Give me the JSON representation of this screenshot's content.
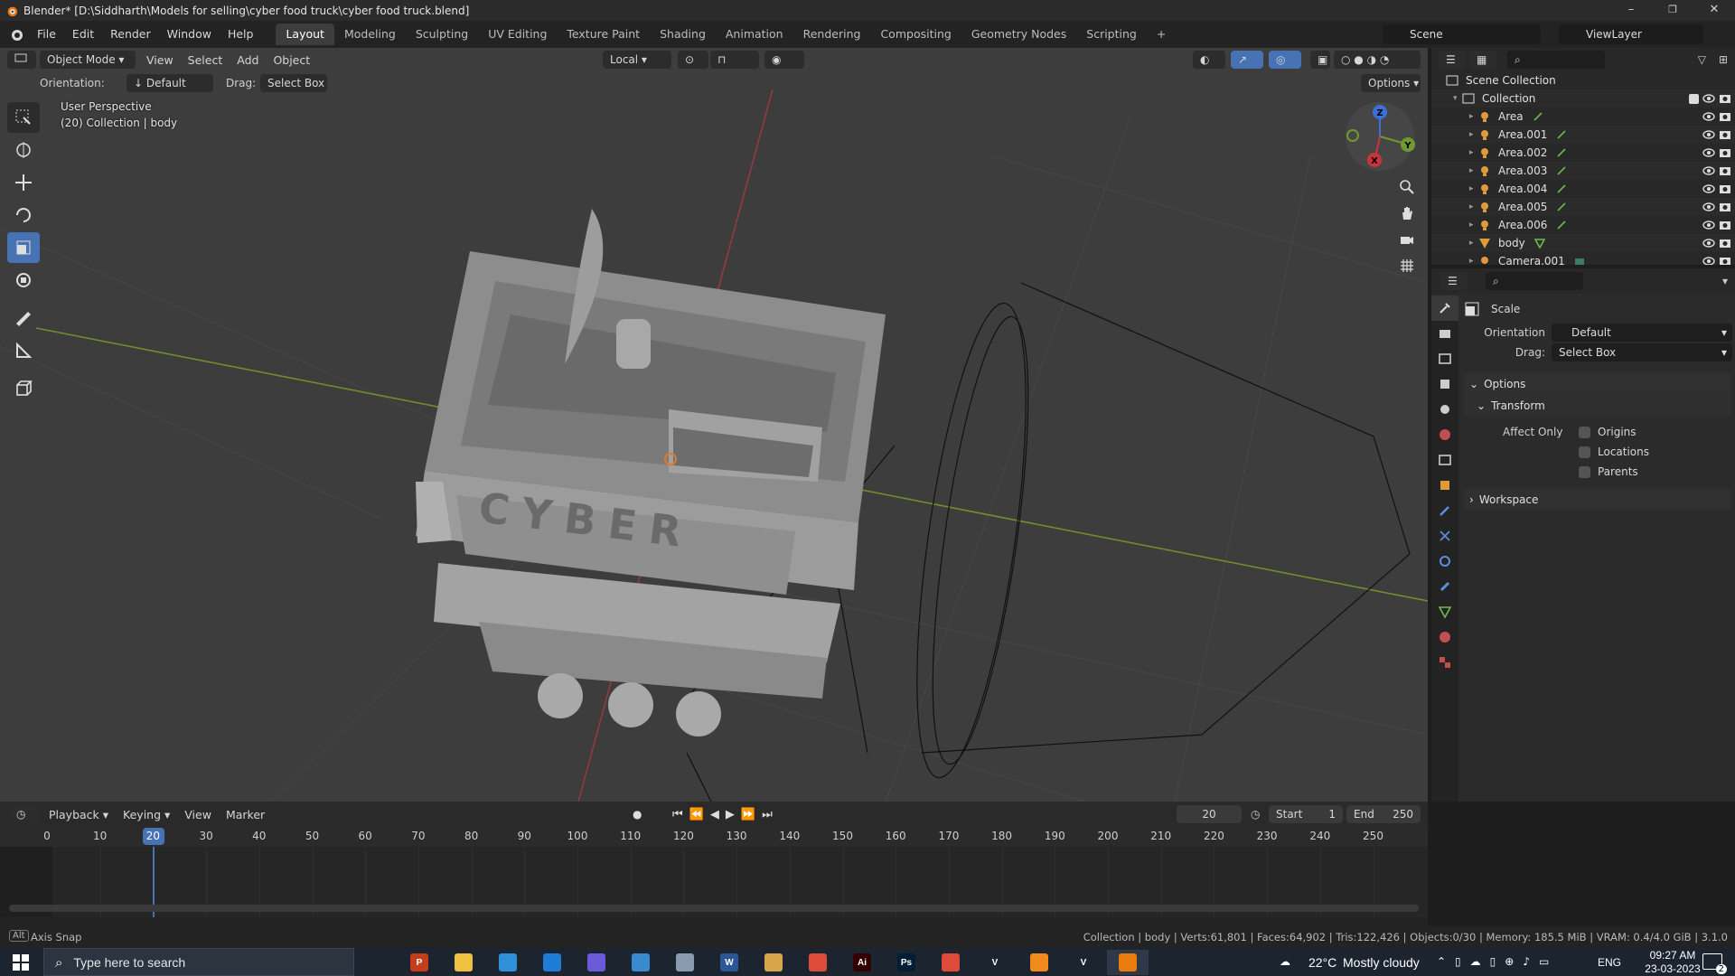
{
  "window": {
    "title": "Blender* [D:\\Siddharth\\Models for selling\\cyber food truck\\cyber food truck.blend]",
    "minimize": "–",
    "maximize": "❐",
    "close": "✕"
  },
  "menu": [
    "File",
    "Edit",
    "Render",
    "Window",
    "Help"
  ],
  "workspaces": [
    {
      "label": "Layout",
      "active": true
    },
    {
      "label": "Modeling"
    },
    {
      "label": "Sculpting"
    },
    {
      "label": "UV Editing"
    },
    {
      "label": "Texture Paint"
    },
    {
      "label": "Shading"
    },
    {
      "label": "Animation"
    },
    {
      "label": "Rendering"
    },
    {
      "label": "Compositing"
    },
    {
      "label": "Geometry Nodes"
    },
    {
      "label": "Scripting"
    },
    {
      "label": "+"
    }
  ],
  "scene": {
    "name": "Scene",
    "view_layer": "ViewLayer"
  },
  "viewport": {
    "mode": "Object Mode",
    "menus": [
      "View",
      "Select",
      "Add",
      "Object"
    ],
    "transform_orientation": "Local",
    "orientation_label": "Orientation:",
    "orientation_value": "Default",
    "drag_label": "Drag:",
    "drag_value": "Select Box",
    "options_label": "Options",
    "perspective": "User Perspective",
    "collection_info": "(20) Collection | body",
    "gizmo": {
      "x": "X",
      "y": "Y",
      "z": "Z"
    },
    "model_text": "CYBER"
  },
  "outliner": {
    "root": "Scene Collection",
    "collection": "Collection",
    "items": [
      {
        "name": "Area",
        "type": "light"
      },
      {
        "name": "Area.001",
        "type": "light"
      },
      {
        "name": "Area.002",
        "type": "light"
      },
      {
        "name": "Area.003",
        "type": "light"
      },
      {
        "name": "Area.004",
        "type": "light"
      },
      {
        "name": "Area.005",
        "type": "light"
      },
      {
        "name": "Area.006",
        "type": "light"
      },
      {
        "name": "body",
        "type": "mesh"
      },
      {
        "name": "Camera.001",
        "type": "camera"
      }
    ]
  },
  "properties": {
    "tool_name": "Scale",
    "orientation_label": "Orientation",
    "orientation_value": "Default",
    "drag_label": "Drag:",
    "drag_value": "Select Box",
    "options_panel": "Options",
    "transform_panel": "Transform",
    "affect_only_label": "Affect Only",
    "affect_options": [
      "Origins",
      "Locations",
      "Parents"
    ],
    "workspace_panel": "Workspace"
  },
  "timeline": {
    "menus": [
      "Playback",
      "Keying",
      "View",
      "Marker"
    ],
    "current_frame": "20",
    "start_label": "Start",
    "start": "1",
    "end_label": "End",
    "end": "250",
    "ticks": [
      "0",
      "10",
      "20",
      "30",
      "40",
      "50",
      "60",
      "70",
      "80",
      "90",
      "100",
      "110",
      "120",
      "130",
      "140",
      "150",
      "160",
      "170",
      "180",
      "190",
      "200",
      "210",
      "220",
      "230",
      "240",
      "250"
    ]
  },
  "status": {
    "left_key": "Alt",
    "left": "Axis Snap",
    "right": "Collection | body | Verts:61,801 | Faces:64,902 | Tris:122,426 | Objects:0/30 | Memory: 185.5 MiB | VRAM: 0.4/4.0 GiB | 3.1.0"
  },
  "taskbar": {
    "search_placeholder": "Type here to search",
    "weather_temp": "22°C",
    "weather_text": "Mostly cloudy",
    "language": "ENG",
    "time": "09:27 AM",
    "date": "23-03-2023",
    "notification_count": "2",
    "apps": [
      {
        "name": "task-view",
        "label": "",
        "color": "#1c2430"
      },
      {
        "name": "powerpoint",
        "label": "P",
        "color": "#c43e1c"
      },
      {
        "name": "file-explorer",
        "label": "",
        "color": "#f0c040"
      },
      {
        "name": "photos",
        "label": "",
        "color": "#2f8fd8"
      },
      {
        "name": "store",
        "label": "",
        "color": "#1e7bd6"
      },
      {
        "name": "copilot",
        "label": "",
        "color": "#6b5bd8"
      },
      {
        "name": "app-blue",
        "label": "",
        "color": "#3a8ad0"
      },
      {
        "name": "app-gray",
        "label": "",
        "color": "#8a9bb0"
      },
      {
        "name": "word",
        "label": "W",
        "color": "#2b5797"
      },
      {
        "name": "app-drive",
        "label": "",
        "color": "#d7a64a"
      },
      {
        "name": "chrome",
        "label": "",
        "color": "#dd4b39"
      },
      {
        "name": "illustrator",
        "label": "Ai",
        "color": "#330000"
      },
      {
        "name": "photoshop",
        "label": "Ps",
        "color": "#001e36"
      },
      {
        "name": "substance",
        "label": "",
        "color": "#e04a3a"
      },
      {
        "name": "app-v1",
        "label": "V",
        "color": "#1c2430"
      },
      {
        "name": "vlc",
        "label": "",
        "color": "#f08a1c"
      },
      {
        "name": "app-v2",
        "label": "V",
        "color": "#1c2430"
      },
      {
        "name": "blender",
        "label": "",
        "color": "#e87d0d"
      }
    ]
  }
}
